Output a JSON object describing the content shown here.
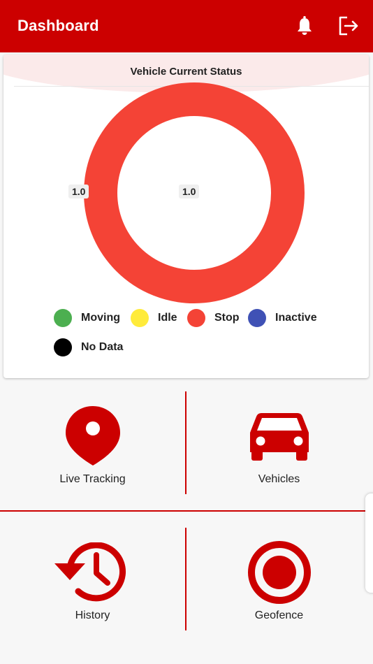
{
  "appbar": {
    "title": "Dashboard",
    "notifications_icon": "bell-icon",
    "logout_icon": "logout-icon"
  },
  "status_card": {
    "title": "Vehicle Current Status",
    "slice_label": "1.0",
    "center_label": "1.0",
    "chart_data": {
      "type": "pie",
      "labels": [
        "Moving",
        "Idle",
        "Stop",
        "Inactive",
        "No Data"
      ],
      "values": [
        0,
        0,
        1.0,
        0,
        0
      ],
      "colors": [
        "#4caf50",
        "#ffeb3b",
        "#f44336",
        "#3f51b5",
        "#000000"
      ]
    },
    "legend": [
      {
        "label": "Moving",
        "color": "#4caf50"
      },
      {
        "label": "Idle",
        "color": "#ffeb3b"
      },
      {
        "label": "Stop",
        "color": "#f44336"
      },
      {
        "label": "Inactive",
        "color": "#3f51b5"
      },
      {
        "label": "No Data",
        "color": "#000000"
      }
    ]
  },
  "tiles": {
    "live_tracking": {
      "label": "Live Tracking",
      "icon": "location-pin-icon"
    },
    "vehicles": {
      "label": "Vehicles",
      "icon": "car-icon"
    },
    "history": {
      "label": "History",
      "icon": "history-icon"
    },
    "geofence": {
      "label": "Geofence",
      "icon": "geofence-icon"
    }
  },
  "colors": {
    "primary": "#cc0000",
    "stop": "#f44336"
  }
}
